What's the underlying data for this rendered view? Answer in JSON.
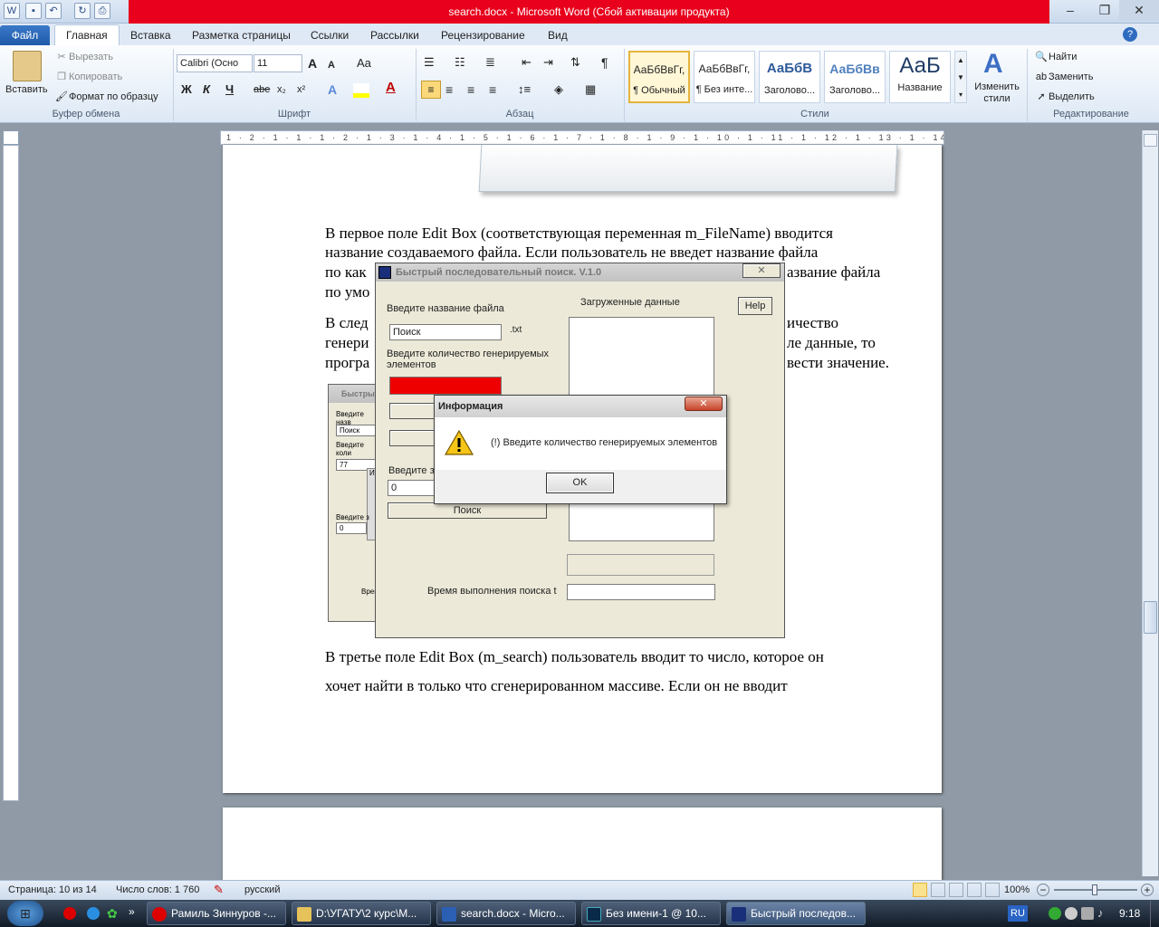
{
  "window": {
    "title": "search.docx - Microsoft Word (Сбой активации продукта)",
    "minimize": "–",
    "maximize": "❐",
    "close": "✕"
  },
  "tabs": [
    "Файл",
    "Главная",
    "Вставка",
    "Разметка страницы",
    "Ссылки",
    "Рассылки",
    "Рецензирование",
    "Вид"
  ],
  "ribbon": {
    "clipboard": {
      "label": "Буфер обмена",
      "paste": "Вставить",
      "cut": "Вырезать",
      "copy": "Копировать",
      "format_painter": "Формат по образцу"
    },
    "font": {
      "label": "Шрифт",
      "name": "Calibri (Осно",
      "size": "11",
      "bold": "Ж",
      "italic": "К",
      "underline": "Ч",
      "strike": "abe",
      "sub": "x₂",
      "sup": "x²",
      "grow": "A",
      "shrink": "A",
      "case": "Aa"
    },
    "paragraph": {
      "label": "Абзац"
    },
    "styles": {
      "label": "Стили",
      "items": [
        {
          "preview": "АаБбВвГг,",
          "name": "¶ Обычный"
        },
        {
          "preview": "АаБбВвГг,",
          "name": "¶ Без инте..."
        },
        {
          "preview": "АаБбВ",
          "name": "Заголово..."
        },
        {
          "preview": "АаБбВв",
          "name": "Заголово..."
        },
        {
          "preview": "АаБ",
          "name": "Название"
        }
      ],
      "change": "Изменить стили"
    },
    "editing": {
      "label": "Редактирование",
      "find": "Найти",
      "replace": "Заменить",
      "select": "Выделить"
    }
  },
  "ruler_marks": "1 · 2 · 1 · 1 · 1 · 2 · 1 · 3 · 1 · 4 · 1 · 5 · 1 · 6 · 1 · 7 · 1 · 8 · 1 · 9 · 1 · 10 · 1 · 11 · 1 · 12 · 1 · 13 · 1 · 14 · 1 · 15 · 1 · 16 · 1 · 17 ·",
  "document": {
    "lines": [
      "В первое поле Edit Box (соответствующая переменная m_FileName) вводится",
      "название создаваемого файла. Если пользователь не введет название файла",
      "по каким-либо причинам, то программа сама присвоит название файла",
      "по умолчанию.",
      "В следующее поле Edit Box вводится количество",
      "генерируемых элементов. Если пользователь не введет в поле данные, то",
      "программа выдаст сообщение о том, что необходимо ввести значение.",
      "В третье поле Edit Box (m_search)  пользователь вводит то число, которое он",
      "хочет найти в только что сгенерированном массиве. Если он не вводит"
    ],
    "visible_fragments": {
      "l3_left": "по как",
      "l3_right": "азвание файла",
      "l4_left": "по умо",
      "l5_left": "В след",
      "l5_right": "ичество",
      "l6_left": "генери",
      "l6_right": "ле данные, то",
      "l7_left": "програ",
      "l7_right": "вести значение."
    }
  },
  "app_dialog": {
    "title": "Быстрый последовательный поиск. V.1.0",
    "filename_label": "Введите название файла",
    "filename_value": "Поиск",
    "ext": ".txt",
    "count_label": "Введите количество генерируемых элементов",
    "search_label": "Введите з",
    "search_value": "0",
    "search_button": "Поиск",
    "loaded_label": "Загруженные данные",
    "help": "Help",
    "time_label": "Время выполнения поиска t"
  },
  "bg_dialog": {
    "title": "Быстрый",
    "l1": "Введите назв",
    "v1": "Поиск",
    "l2": "Введите коли элементов",
    "v2": "77",
    "l3": "Введите з",
    "v3": "0",
    "l4": "Врем",
    "inner": "Ин"
  },
  "message_box": {
    "title": "Информация",
    "text": "(!) Введите количество генерируемых элементов",
    "ok": "OK"
  },
  "status": {
    "page": "Страница: 10 из 14",
    "words": "Число слов: 1 760",
    "lang": "русский",
    "zoom": "100%"
  },
  "taskbar": {
    "items": [
      "Рамиль Зиннуров -...",
      "D:\\УГАТУ\\2 курс\\М...",
      "search.docx - Micro...",
      "Без имени-1 @ 10...",
      "Быстрый последов..."
    ],
    "lang": "RU",
    "clock": "9:18"
  },
  "colors": {
    "accent": "#1f5aa8",
    "title_red": "#e8001c",
    "field_red": "#ee0000"
  }
}
